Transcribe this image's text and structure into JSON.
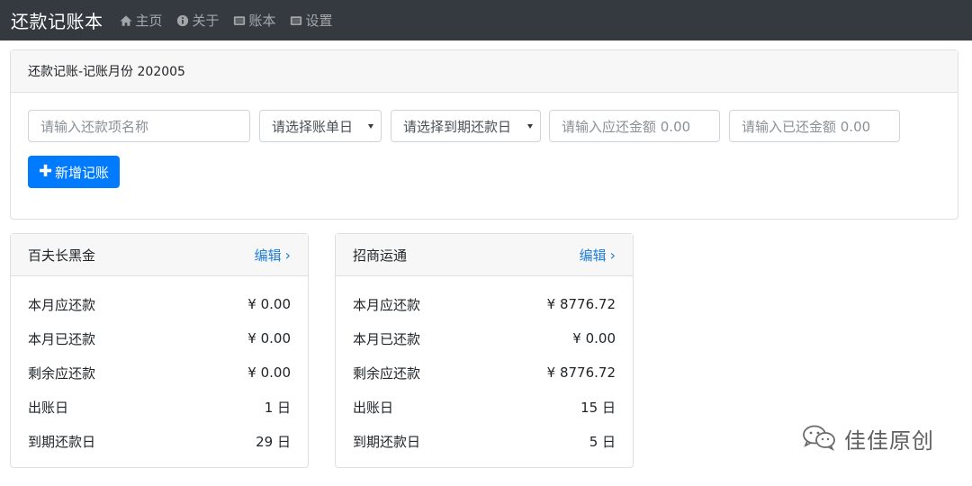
{
  "navbar": {
    "brand": "还款记账本",
    "links": [
      {
        "label": "主页",
        "icon": "home-icon"
      },
      {
        "label": "关于",
        "icon": "info-icon"
      },
      {
        "label": "账本",
        "icon": "ledger-icon"
      },
      {
        "label": "设置",
        "icon": "settings-icon"
      }
    ]
  },
  "form": {
    "title": "还款记账-记账月份 202005",
    "name_placeholder": "请输入还款项名称",
    "bill_day_select": "请选择账单日",
    "due_day_select": "请选择到期还款日",
    "due_amount_placeholder": "请输入应还金额 0.00",
    "paid_amount_placeholder": "请输入已还金额 0.00",
    "add_button": "新增记账"
  },
  "accounts": [
    {
      "name": "百夫长黑金",
      "edit_label": "编辑",
      "rows": [
        {
          "label": "本月应还款",
          "value": "¥ 0.00"
        },
        {
          "label": "本月已还款",
          "value": "¥ 0.00"
        },
        {
          "label": "剩余应还款",
          "value": "¥ 0.00"
        },
        {
          "label": "出账日",
          "value": "1 日"
        },
        {
          "label": "到期还款日",
          "value": "29 日"
        }
      ]
    },
    {
      "name": "招商运通",
      "edit_label": "编辑",
      "rows": [
        {
          "label": "本月应还款",
          "value": "¥ 8776.72"
        },
        {
          "label": "本月已还款",
          "value": "¥ 0.00"
        },
        {
          "label": "剩余应还款",
          "value": "¥ 8776.72"
        },
        {
          "label": "出账日",
          "value": "15 日"
        },
        {
          "label": "到期还款日",
          "value": "5 日"
        }
      ]
    }
  ],
  "watermark": {
    "text": "佳佳原创",
    "icon": "wechat-icon"
  },
  "colors": {
    "navbar": "#343a40",
    "primary": "#007bff",
    "link": "#1e7ed8"
  }
}
